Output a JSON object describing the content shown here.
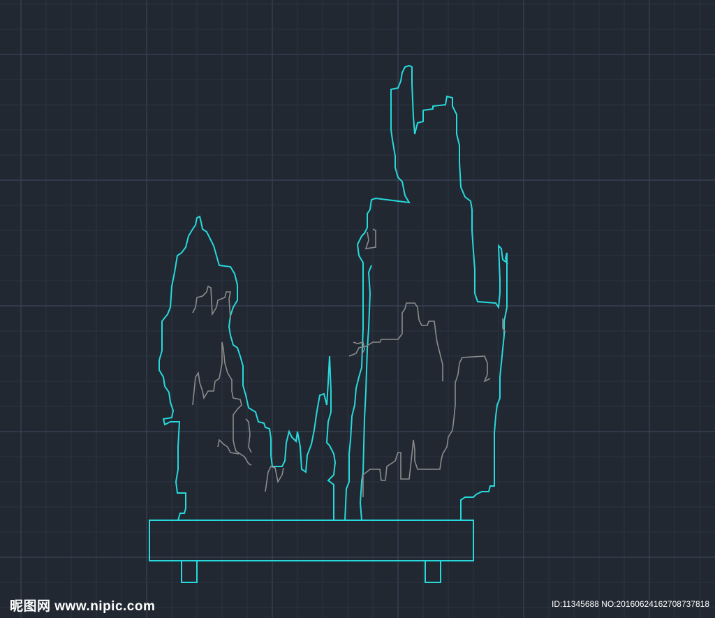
{
  "colors": {
    "background": "#212832",
    "grid_minor": "#2b3441",
    "grid_major": "#3a4456",
    "outline": "#27d9dc",
    "detail": "#8c8c8c",
    "watermark": "#ffffff"
  },
  "drawing": {
    "subject": "rockery-on-stand",
    "elements": [
      "left-rock-peak",
      "right-rock-peak",
      "base-plinth",
      "left-foot",
      "right-foot",
      "inner-texture-lines"
    ]
  },
  "watermark": {
    "site": "昵图网 www.nipic.com",
    "id_text": "ID:11345688 NO:20160624162708737818"
  }
}
